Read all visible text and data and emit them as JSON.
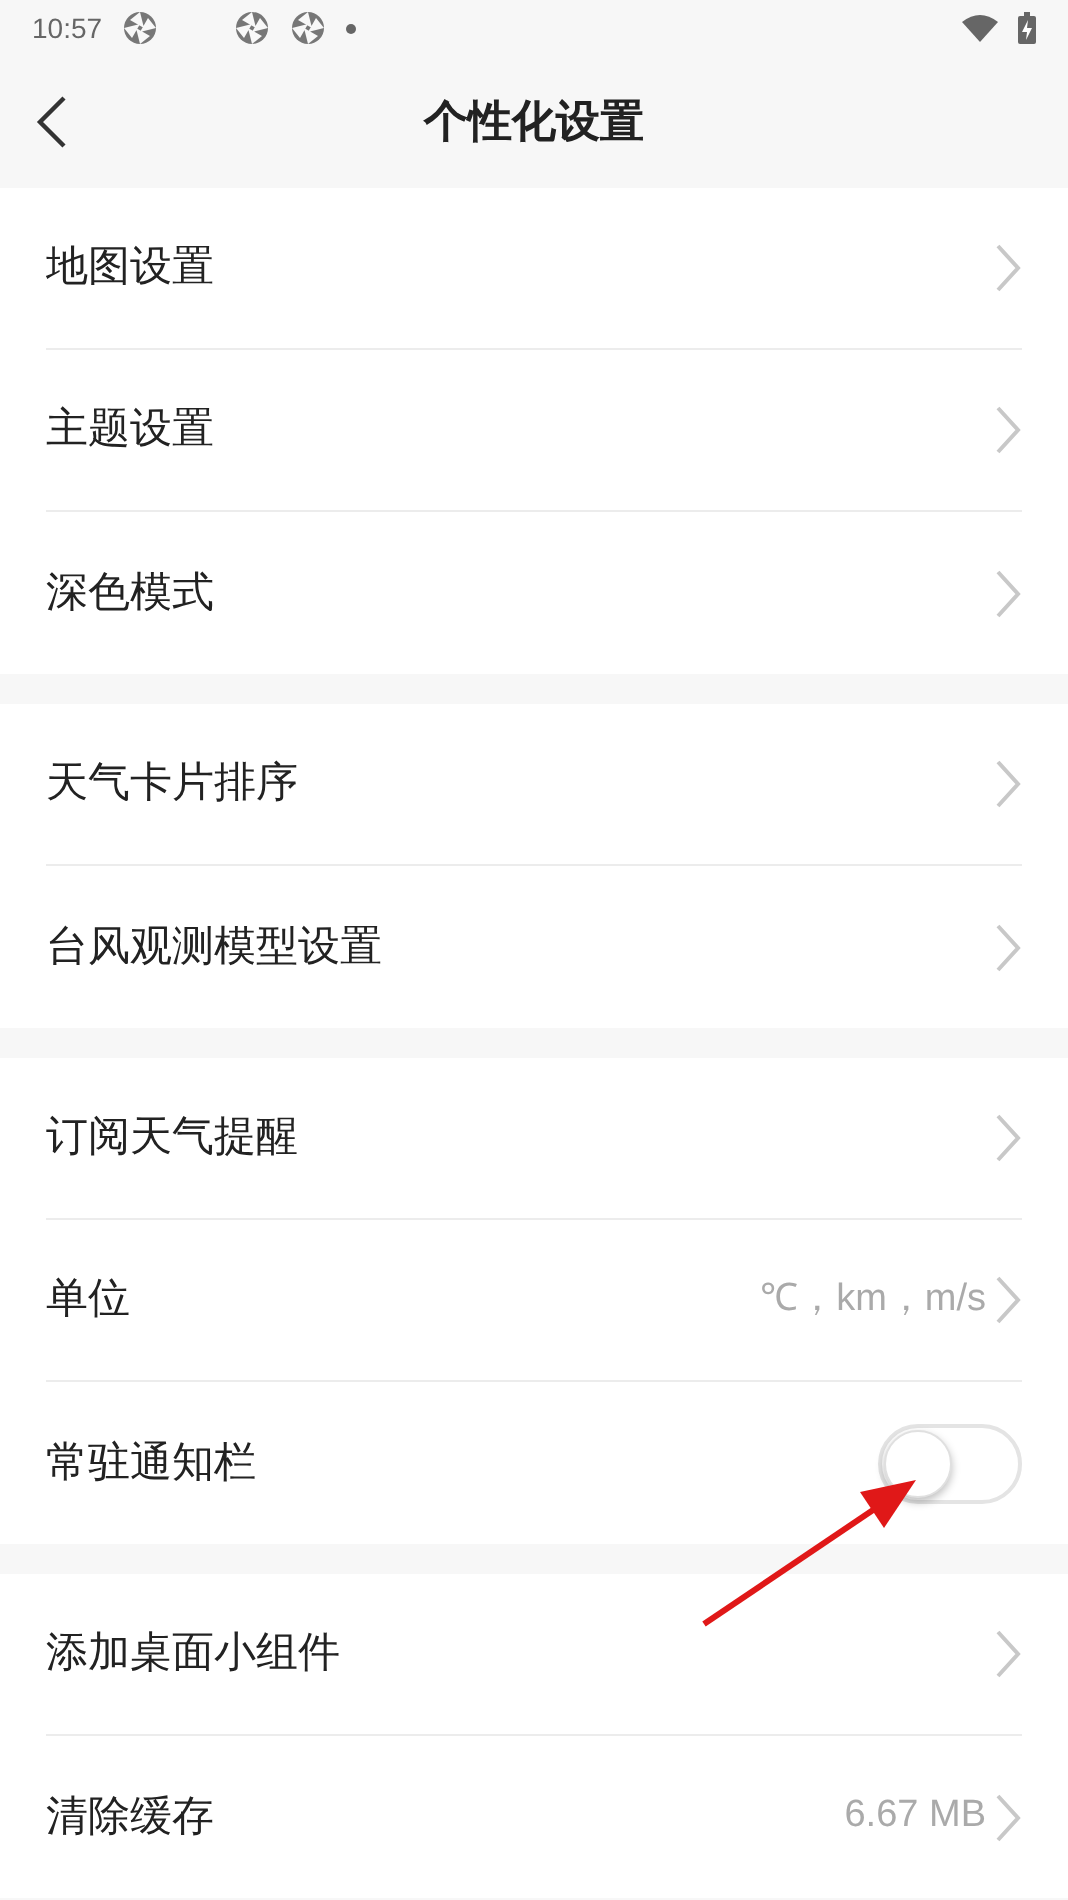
{
  "status_bar": {
    "time": "10:57"
  },
  "header": {
    "title": "个性化设置"
  },
  "groups": [
    {
      "items": [
        {
          "kind": "link",
          "label": "地图设置"
        },
        {
          "kind": "link",
          "label": "主题设置"
        },
        {
          "kind": "link",
          "label": "深色模式"
        }
      ]
    },
    {
      "items": [
        {
          "kind": "link",
          "label": "天气卡片排序"
        },
        {
          "kind": "link",
          "label": "台风观测模型设置"
        }
      ]
    },
    {
      "items": [
        {
          "kind": "link",
          "label": "订阅天气提醒"
        },
        {
          "kind": "link",
          "label": "单位",
          "value": "℃，km，m/s"
        },
        {
          "kind": "toggle",
          "label": "常驻通知栏",
          "on": false
        }
      ]
    },
    {
      "items": [
        {
          "kind": "link",
          "label": "添加桌面小组件"
        },
        {
          "kind": "link",
          "label": "清除缓存",
          "value": "6.67 MB"
        }
      ]
    }
  ]
}
